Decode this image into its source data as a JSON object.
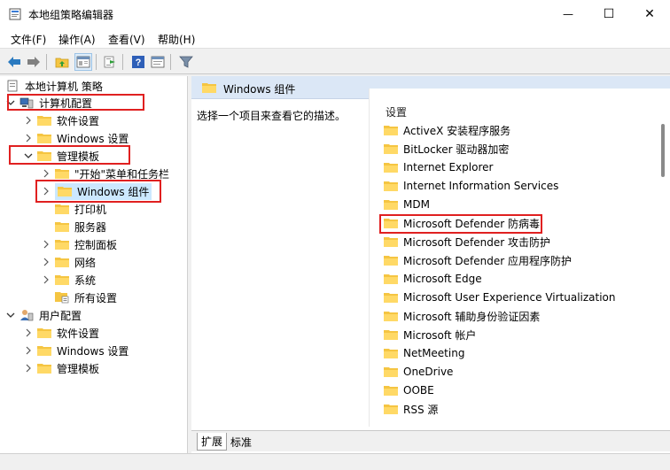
{
  "window": {
    "title": "本地组策略编辑器",
    "minimize_glyph": "—",
    "maximize_glyph": "☐",
    "close_glyph": "✕"
  },
  "menu": {
    "items": [
      {
        "label": "文件(F)"
      },
      {
        "label": "操作(A)"
      },
      {
        "label": "查看(V)"
      },
      {
        "label": "帮助(H)"
      }
    ]
  },
  "toolbar": {
    "icons": [
      "back-arrow-icon",
      "forward-arrow-icon",
      "up-folder-icon",
      "show-hide-tree-icon",
      "export-list-icon",
      "help-icon",
      "properties-icon",
      "filter-icon"
    ]
  },
  "tree": {
    "root": {
      "label": "本地计算机 策略"
    },
    "computer_config": {
      "label": "计算机配置"
    },
    "cc_software": {
      "label": "软件设置"
    },
    "cc_windows": {
      "label": "Windows 设置"
    },
    "cc_admin": {
      "label": "管理模板"
    },
    "cc_admin_start": {
      "label": "\"开始\"菜单和任务栏"
    },
    "cc_admin_windows": {
      "label": "Windows 组件"
    },
    "cc_admin_printer": {
      "label": "打印机"
    },
    "cc_admin_server": {
      "label": "服务器"
    },
    "cc_admin_control": {
      "label": "控制面板"
    },
    "cc_admin_network": {
      "label": "网络"
    },
    "cc_admin_system": {
      "label": "系统"
    },
    "cc_admin_all": {
      "label": "所有设置"
    },
    "user_config": {
      "label": "用户配置"
    },
    "uc_software": {
      "label": "软件设置"
    },
    "uc_windows": {
      "label": "Windows 设置"
    },
    "uc_admin": {
      "label": "管理模板"
    }
  },
  "right": {
    "header": "Windows 组件",
    "description": "选择一个项目来查看它的描述。",
    "list_header": "设置",
    "items": [
      {
        "label": "ActiveX 安装程序服务"
      },
      {
        "label": "BitLocker 驱动器加密"
      },
      {
        "label": "Internet Explorer"
      },
      {
        "label": "Internet Information Services"
      },
      {
        "label": "MDM"
      },
      {
        "label": "Microsoft Defender 防病毒"
      },
      {
        "label": "Microsoft Defender 攻击防护"
      },
      {
        "label": "Microsoft Defender 应用程序防护"
      },
      {
        "label": "Microsoft Edge"
      },
      {
        "label": "Microsoft User Experience Virtualization"
      },
      {
        "label": "Microsoft 辅助身份验证因素"
      },
      {
        "label": "Microsoft 帐户"
      },
      {
        "label": "NetMeeting"
      },
      {
        "label": "OneDrive"
      },
      {
        "label": "OOBE"
      },
      {
        "label": "RSS 源"
      }
    ]
  },
  "tabs": {
    "extended": "扩展",
    "standard": "标准"
  },
  "colors": {
    "highlight": "#e02020",
    "folder": "#f5c542",
    "selected": "#cce8ff"
  }
}
